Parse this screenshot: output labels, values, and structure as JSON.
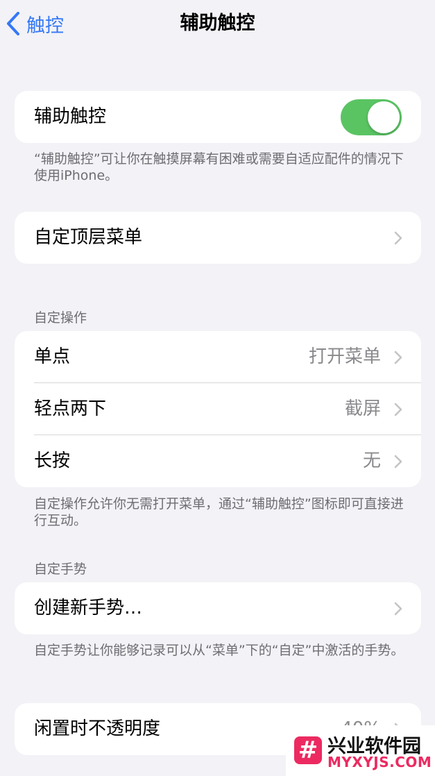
{
  "nav": {
    "back_label": "触控",
    "title": "辅助触控"
  },
  "main_toggle": {
    "label": "辅助触控",
    "on": true
  },
  "main_footer": "“辅助触控”可让你在触摸屏幕有困难或需要自适应配件的情况下使用iPhone。",
  "top_menu": {
    "label": "自定顶层菜单"
  },
  "custom_actions": {
    "header": "自定操作",
    "rows": [
      {
        "label": "单点",
        "value": "打开菜单"
      },
      {
        "label": "轻点两下",
        "value": "截屏"
      },
      {
        "label": "长按",
        "value": "无"
      }
    ],
    "footer": "自定操作允许你无需打开菜单，通过“辅助触控”图标即可直接进行互动。"
  },
  "custom_gestures": {
    "header": "自定手势",
    "create_label": "创建新手势…",
    "footer": "自定手势让你能够记录可以从“菜单”下的“自定”中激活的手势。"
  },
  "idle_opacity": {
    "label": "闲置时不透明度",
    "value": "40%"
  },
  "watermark": {
    "mark": "#",
    "top": "兴业软件园",
    "bottom": "MYXYJS.COM"
  },
  "colors": {
    "accent": "#3478f6",
    "toggle_on": "#5ac463",
    "background": "#f2f2f7",
    "watermark": "#ec2a61"
  }
}
